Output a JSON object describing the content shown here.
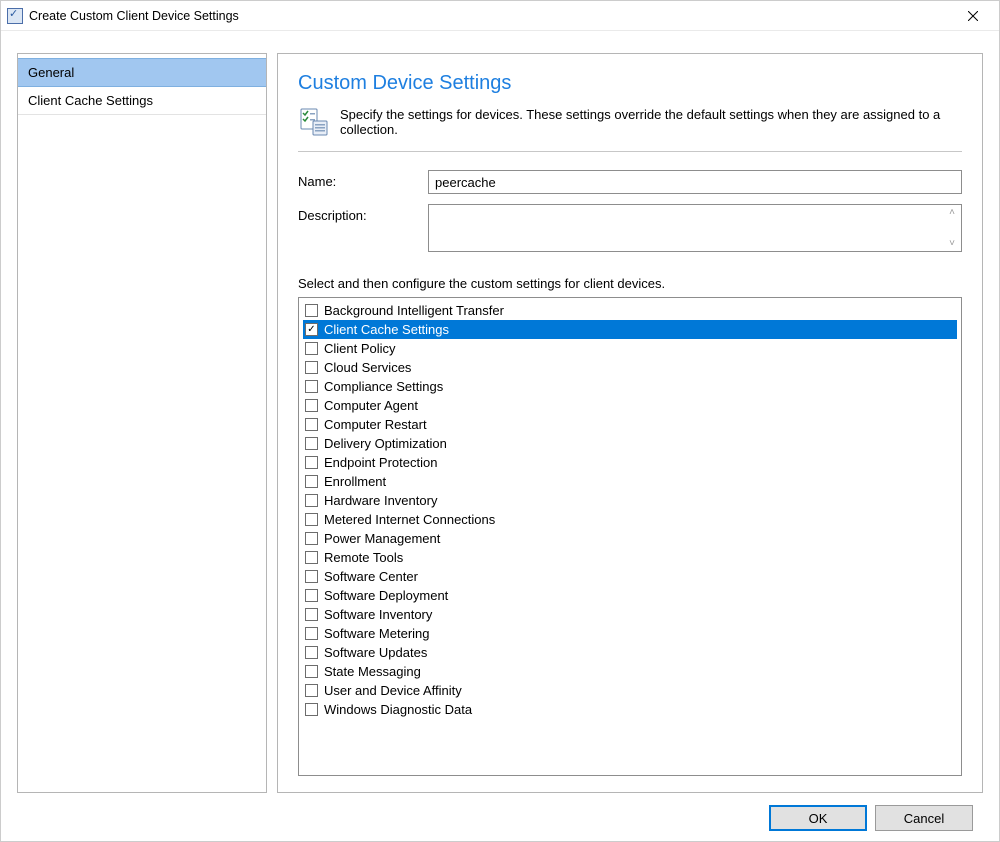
{
  "window": {
    "title": "Create Custom Client Device Settings"
  },
  "sidebar": {
    "items": [
      {
        "label": "General",
        "selected": true
      },
      {
        "label": "Client Cache Settings",
        "selected": false
      }
    ]
  },
  "main": {
    "heading": "Custom Device Settings",
    "instructions": "Specify the settings for devices. These settings override the default settings when they are assigned to a collection.",
    "name_label": "Name:",
    "name_value": "peercache",
    "description_label": "Description:",
    "description_value": "",
    "select_label": "Select and then configure the custom settings for client devices.",
    "settings": [
      {
        "label": "Background Intelligent Transfer",
        "checked": false,
        "selected": false
      },
      {
        "label": "Client Cache Settings",
        "checked": true,
        "selected": true
      },
      {
        "label": "Client Policy",
        "checked": false,
        "selected": false
      },
      {
        "label": "Cloud Services",
        "checked": false,
        "selected": false
      },
      {
        "label": "Compliance Settings",
        "checked": false,
        "selected": false
      },
      {
        "label": "Computer Agent",
        "checked": false,
        "selected": false
      },
      {
        "label": "Computer Restart",
        "checked": false,
        "selected": false
      },
      {
        "label": "Delivery Optimization",
        "checked": false,
        "selected": false
      },
      {
        "label": "Endpoint Protection",
        "checked": false,
        "selected": false
      },
      {
        "label": "Enrollment",
        "checked": false,
        "selected": false
      },
      {
        "label": "Hardware Inventory",
        "checked": false,
        "selected": false
      },
      {
        "label": "Metered Internet Connections",
        "checked": false,
        "selected": false
      },
      {
        "label": "Power Management",
        "checked": false,
        "selected": false
      },
      {
        "label": "Remote Tools",
        "checked": false,
        "selected": false
      },
      {
        "label": "Software Center",
        "checked": false,
        "selected": false
      },
      {
        "label": "Software Deployment",
        "checked": false,
        "selected": false
      },
      {
        "label": "Software Inventory",
        "checked": false,
        "selected": false
      },
      {
        "label": "Software Metering",
        "checked": false,
        "selected": false
      },
      {
        "label": "Software Updates",
        "checked": false,
        "selected": false
      },
      {
        "label": "State Messaging",
        "checked": false,
        "selected": false
      },
      {
        "label": "User and Device Affinity",
        "checked": false,
        "selected": false
      },
      {
        "label": "Windows Diagnostic Data",
        "checked": false,
        "selected": false
      }
    ]
  },
  "buttons": {
    "ok": "OK",
    "cancel": "Cancel"
  }
}
